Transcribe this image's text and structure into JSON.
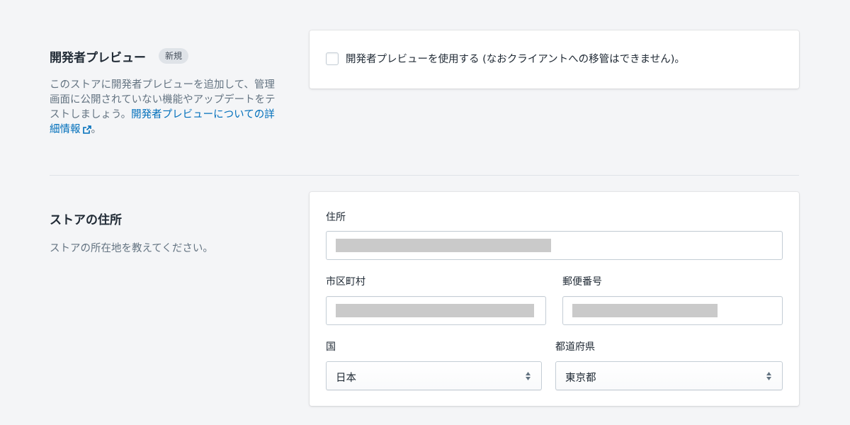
{
  "developer_preview": {
    "title": "開発者プレビュー",
    "badge": "新規",
    "description": "このストアに開発者プレビューを追加して、管理画面に公開されていない機能やアップデートをテストしましょう。",
    "link_text": "開発者プレビューについての詳細情報",
    "trailing_text": "。",
    "checkbox_label": "開発者プレビューを使用する (なおクライアントへの移管はできません)。",
    "checkbox_checked": false
  },
  "store_address": {
    "title": "ストアの住所",
    "description": "ストアの所在地を教えてください。",
    "fields": {
      "address_label": "住所",
      "city_label": "市区町村",
      "postal_label": "郵便番号",
      "country_label": "国",
      "prefecture_label": "都道府県"
    },
    "country_value": "日本",
    "prefecture_value": "東京都"
  },
  "colors": {
    "link": "#006fbb",
    "background": "#f4f5f7",
    "redaction": "#cacaca"
  }
}
